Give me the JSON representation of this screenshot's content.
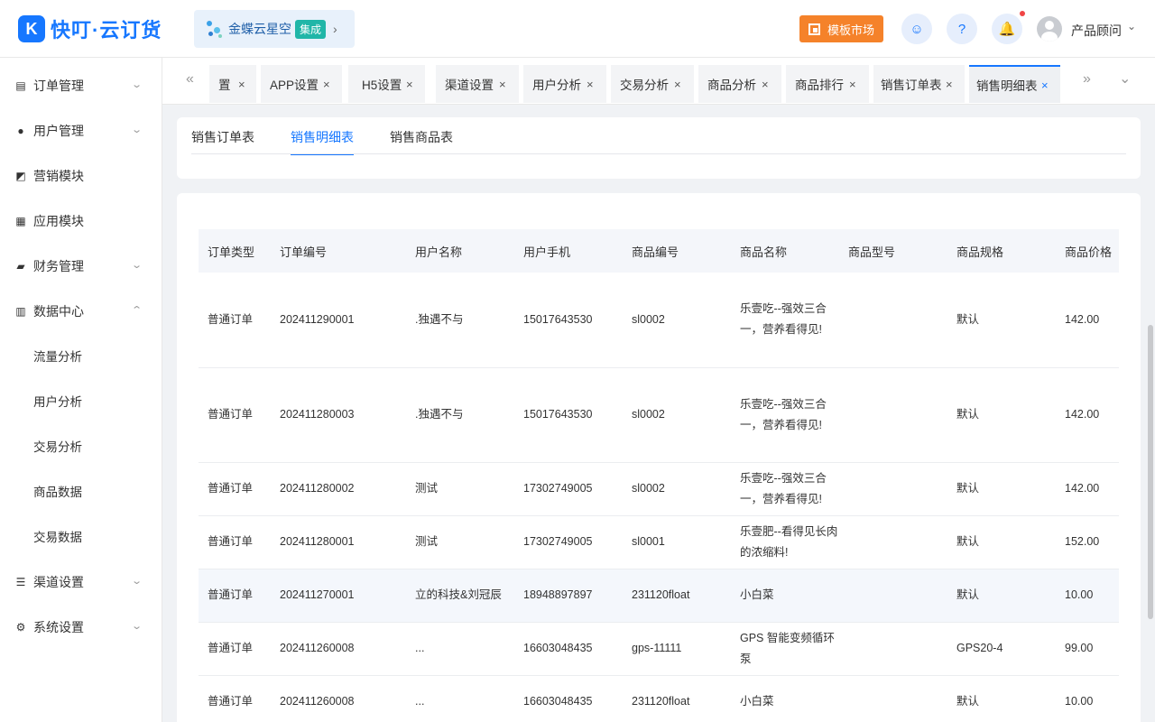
{
  "app": {
    "logo_text": "快叮·云订货",
    "logo_glyph": "K"
  },
  "brand": {
    "name": "金蝶云星空",
    "tag": "集成",
    "arrow": "›"
  },
  "header": {
    "market_label": "模板市场",
    "user_name": "产品顾问",
    "user_caret": "⌄",
    "icons": [
      "headset-icon",
      "help-icon",
      "bell-icon"
    ],
    "icon_glyphs": [
      "☺",
      "?",
      "🔔"
    ]
  },
  "sidebar": {
    "items": [
      {
        "label": "订单管理",
        "icon": "clipboard-icon",
        "glyph": "▤",
        "expandable": true,
        "chevron": "⌄"
      },
      {
        "label": "用户管理",
        "icon": "user-icon",
        "glyph": "●",
        "expandable": true,
        "chevron": "⌄"
      },
      {
        "label": "营销模块",
        "icon": "chart-icon",
        "glyph": "◩",
        "expandable": false
      },
      {
        "label": "应用模块",
        "icon": "grid-icon",
        "glyph": "▦",
        "expandable": false
      },
      {
        "label": "财务管理",
        "icon": "wallet-icon",
        "glyph": "▰",
        "expandable": true,
        "chevron": "⌄"
      },
      {
        "label": "数据中心",
        "icon": "bar-chart-icon",
        "glyph": "▥",
        "expandable": true,
        "chevron": "⌃"
      },
      {
        "label": "渠道设置",
        "icon": "list-icon",
        "glyph": "☰",
        "expandable": true,
        "chevron": "⌄"
      },
      {
        "label": "系统设置",
        "icon": "gear-icon",
        "glyph": "⚙",
        "expandable": true,
        "chevron": "⌄"
      }
    ],
    "sub_items": [
      "流量分析",
      "用户分析",
      "交易分析",
      "商品数据",
      "交易数据"
    ]
  },
  "tabs": {
    "items": [
      "置",
      "APP设置",
      "H5设置",
      "渠道设置",
      "用户分析",
      "交易分析",
      "商品分析",
      "商品排行",
      "销售订单表",
      "销售明细表"
    ],
    "active": "销售明细表",
    "close": "×",
    "nav_left": "«",
    "nav_right": "»",
    "dropdown": "⌄"
  },
  "subtabs": {
    "items": [
      "销售订单表",
      "销售明细表",
      "销售商品表"
    ],
    "active": "销售明细表"
  },
  "table": {
    "columns": [
      "订单类型",
      "订单编号",
      "用户名称",
      "用户手机",
      "商品编号",
      "商品名称",
      "商品型号",
      "商品规格",
      "商品价格"
    ],
    "rows": [
      {
        "type": "普通订单",
        "order_no": "202411290001",
        "user": ".独遇不与",
        "phone": "15017643530",
        "sku": "sl0002",
        "name": "乐壹吃--强效三合一，营养看得见!",
        "model": "",
        "spec": "默认",
        "price": "142.00"
      },
      {
        "type": "普通订单",
        "order_no": "202411280003",
        "user": ".独遇不与",
        "phone": "15017643530",
        "sku": "sl0002",
        "name": "乐壹吃--强效三合一，营养看得见!",
        "model": "",
        "spec": "默认",
        "price": "142.00"
      },
      {
        "type": "普通订单",
        "order_no": "202411280002",
        "user": "测试",
        "phone": "17302749005",
        "sku": "sl0002",
        "name": "乐壹吃--强效三合一，营养看得见!",
        "model": "",
        "spec": "默认",
        "price": "142.00"
      },
      {
        "type": "普通订单",
        "order_no": "202411280001",
        "user": "测试",
        "phone": "17302749005",
        "sku": "sl0001",
        "name": "乐壹肥--看得见长肉的浓缩料!",
        "model": "",
        "spec": "默认",
        "price": "152.00"
      },
      {
        "type": "普通订单",
        "order_no": "202411270001",
        "user": "立的科技&刘冠辰",
        "phone": "18948897897",
        "sku": "231120float",
        "name": "小白菜",
        "model": "",
        "spec": "默认",
        "price": "10.00"
      },
      {
        "type": "普通订单",
        "order_no": "202411260008",
        "user": "...",
        "phone": "16603048435",
        "sku": "gps-11111",
        "name": "GPS 智能变频循环泵",
        "model": "",
        "spec": "GPS20-4",
        "price": "99.00"
      },
      {
        "type": "普通订单",
        "order_no": "202411260008",
        "user": "...",
        "phone": "16603048435",
        "sku": "231120float",
        "name": "小白菜",
        "model": "",
        "spec": "默认",
        "price": "10.00"
      }
    ]
  }
}
